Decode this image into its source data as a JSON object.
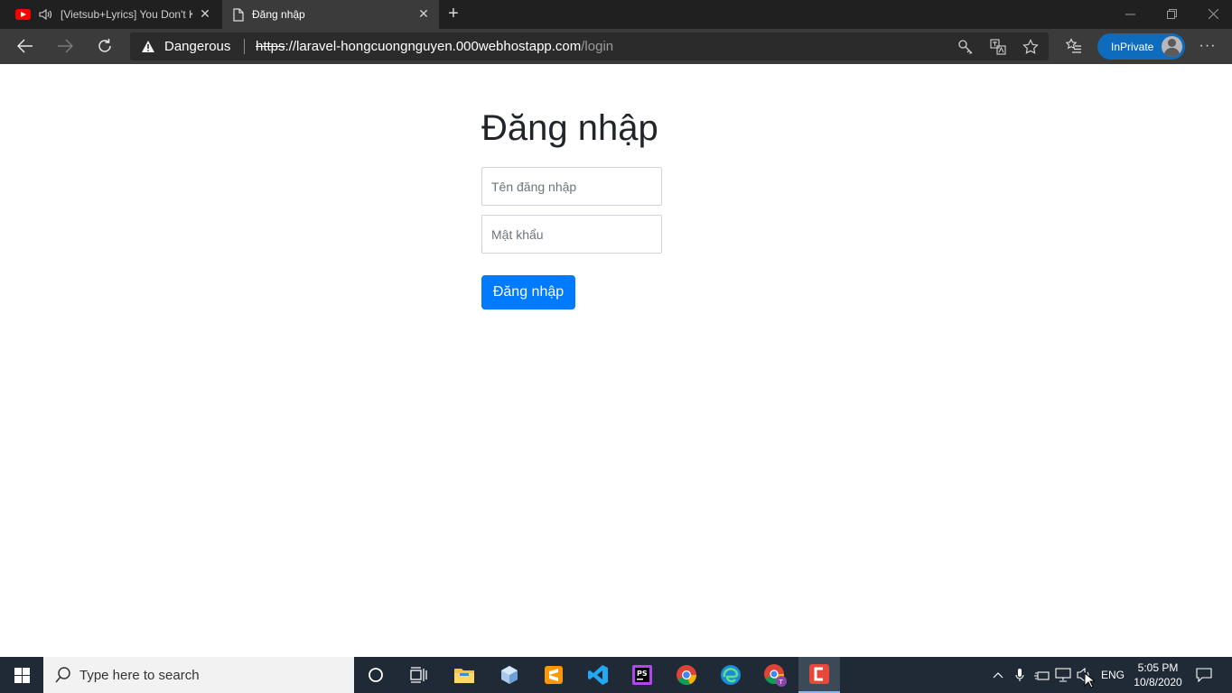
{
  "browser": {
    "tabs": [
      {
        "title": "[Vietsub+Lyrics] You Don't K",
        "close": "✕"
      },
      {
        "title": "Đăng nhập",
        "close": "✕"
      }
    ],
    "new_tab": "+",
    "address": {
      "security_label": "Dangerous",
      "url_protocol": "https",
      "url_host": "://laravel-hongcuongnguyen.000webhostapp.com",
      "url_path": "/login"
    },
    "inprivate_label": "InPrivate",
    "more_label": "···"
  },
  "page": {
    "title": "Đăng nhập",
    "username_placeholder": "Tên đăng nhập",
    "password_placeholder": "Mật khẩu",
    "submit_label": "Đăng nhập"
  },
  "taskbar": {
    "search_placeholder": "Type here to search",
    "language": "ENG",
    "time": "5:05 PM",
    "date": "10/8/2020"
  },
  "colors": {
    "primary_button": "#007bff",
    "inprivate_badge": "#0f6cbd",
    "youtube": "#ff0000"
  }
}
